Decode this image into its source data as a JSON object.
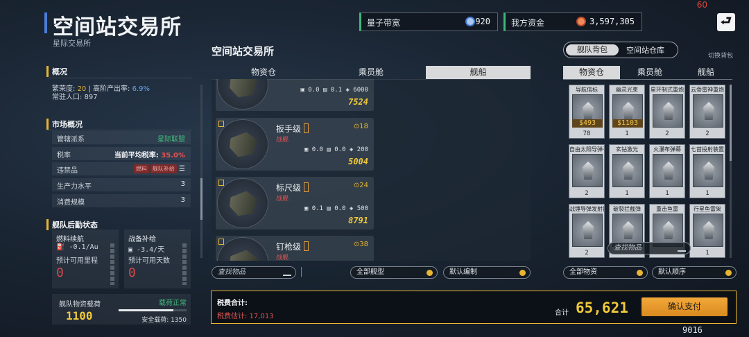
{
  "fps": "60",
  "header": {
    "title": "空间站交易所",
    "subtitle": "星际交易所",
    "bandwidth_label": "量子带宽",
    "bandwidth_value": "920",
    "funds_label": "我方资金",
    "funds_value": "3,597,305",
    "exit_icon": "exit-arrow-icon"
  },
  "overview": {
    "heading": "概况",
    "line1_prefix": "繁荣度: ",
    "prosperity": "20",
    "line1_mid": " | 高阶产出率: ",
    "high_output": "6.9%",
    "line2": "常驻人口: 897"
  },
  "market": {
    "heading": "市场概况",
    "rows": [
      {
        "label": "管辖派系",
        "value": "星际联盟",
        "color": "#3fb87a"
      },
      {
        "label": "税率",
        "value_prefix": "当前平均税率: ",
        "value": "35.0%",
        "color": "#e05454"
      },
      {
        "label": "违禁品",
        "tags": [
          "燃料",
          "舰队补给"
        ]
      },
      {
        "label": "生产力水平",
        "value": "3"
      },
      {
        "label": "消费规模",
        "value": "3"
      }
    ]
  },
  "fleet": {
    "heading": "舰队后勤状态",
    "fuel_title": "燃料续航",
    "fuel_rate": "-0.1/Au",
    "fuel_sub": "预计可用里程",
    "fuel_value": "0",
    "supply_title": "战备补给",
    "supply_rate": "-3.4/天",
    "supply_sub": "预计可用天数",
    "supply_value": "0",
    "cargo_title": "舰队物资载荷",
    "cargo_status": "载荷正常",
    "cargo_value": "1100",
    "safe_load": "安全载荷: 1350",
    "load_fraction": 0.81
  },
  "center": {
    "title": "空间站交易所",
    "tabs": [
      "物资仓",
      "乘员舱",
      "舰船"
    ],
    "active_tab": 2,
    "ships": [
      {
        "name": "",
        "type": "",
        "level": "",
        "stats": "▣ 0.0  ▤ 0.1  ◈ 6000",
        "price": "7524"
      },
      {
        "name": "扳手级",
        "type": "战舰",
        "level": "⊙18",
        "stats": "▣ 0.0  ▤ 0.0  ◈ 200",
        "price": "5004"
      },
      {
        "name": "标尺级",
        "type": "战舰",
        "level": "⊙24",
        "stats": "▣ 0.1  ▤ 0.0  ◈ 500",
        "price": "8791"
      },
      {
        "name": "钉枪级",
        "type": "战舰",
        "level": "⊙38",
        "stats": "",
        "price": ""
      }
    ],
    "search_placeholder": "查找物品",
    "filter_type": "全部舰型",
    "filter_order": "默认编制"
  },
  "right": {
    "toggle_a": "舰队背包",
    "toggle_b": "空间站仓库",
    "swap": "切换背包",
    "tabs": [
      "物资仓",
      "乘员舱",
      "舰船"
    ],
    "active_tab": 0,
    "items": [
      {
        "name": "导航信标",
        "price": "$493",
        "count": "78"
      },
      {
        "name": "幽灵光束",
        "price": "$1103",
        "count": "1"
      },
      {
        "name": "星环制式重炮",
        "price": "",
        "count": "2"
      },
      {
        "name": "云骨雷神重炮",
        "price": "",
        "count": "2"
      },
      {
        "name": "自由太阳导弹子模",
        "price": "",
        "count": "2"
      },
      {
        "name": "玄钻激光",
        "price": "",
        "count": "1"
      },
      {
        "name": "火瀑布弹幕",
        "price": "",
        "count": "1"
      },
      {
        "name": "七首投射装置",
        "price": "",
        "count": "1"
      },
      {
        "name": "战锤导弹发射器",
        "price": "",
        "count": "2"
      },
      {
        "name": "破裂拦截弹",
        "price": "",
        "count": ""
      },
      {
        "name": "重击鱼雷",
        "price": "",
        "count": ""
      },
      {
        "name": "行星鱼雷架",
        "price": "",
        "count": "1"
      }
    ],
    "search_placeholder": "查找物品",
    "filter_all": "全部物资",
    "filter_order": "默认顺序"
  },
  "tax": {
    "label": "税费合计:",
    "estimate": "税费估计: 17,013",
    "total_label": "合计",
    "total": "65,621",
    "confirm": "确认支付"
  },
  "footer_number": "9016"
}
